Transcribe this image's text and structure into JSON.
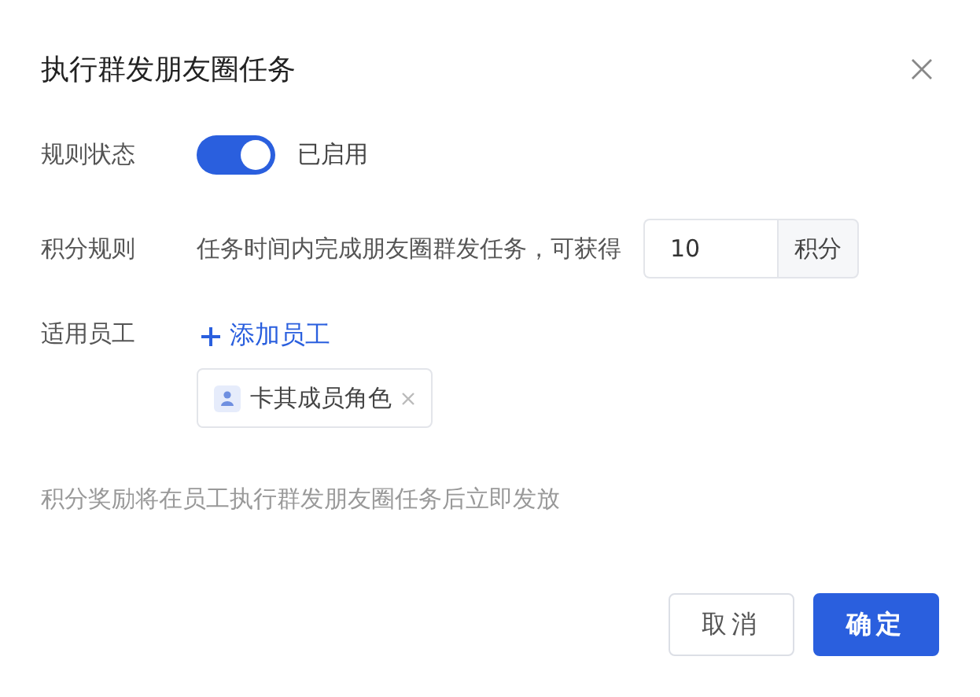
{
  "dialog": {
    "title": "执行群发朋友圈任务"
  },
  "status_rule": {
    "label": "规则状态",
    "on": true,
    "state_text": "已启用"
  },
  "points_rule": {
    "label": "积分规则",
    "text": "任务时间内完成朋友圈群发任务，可获得",
    "value": "10",
    "unit": "积分"
  },
  "staff": {
    "label": "适用员工",
    "add_link": "添加员工",
    "tags": [
      {
        "label": "卡其成员角色"
      }
    ]
  },
  "note": "积分奖励将在员工执行群发朋友圈任务后立即发放",
  "buttons": [
    {
      "label": "取消",
      "kind": "secondary"
    },
    {
      "label": "确定",
      "kind": "primary"
    }
  ]
}
